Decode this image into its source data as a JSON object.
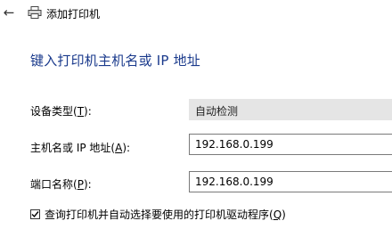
{
  "window": {
    "title": "添加打印机",
    "back_glyph": "←"
  },
  "heading": "键入打印机主机名或 IP 地址",
  "fields": {
    "device_type": {
      "label_pre": "设备类型(",
      "label_key": "T",
      "label_post": "):",
      "value": "自动检测"
    },
    "host": {
      "label_pre": "主机名或 IP 地址(",
      "label_key": "A",
      "label_post": "):",
      "value": "192.168.0.199"
    },
    "port": {
      "label_pre": "端口名称(",
      "label_key": "P",
      "label_post": "):",
      "value": "192.168.0.199"
    }
  },
  "query_checkbox": {
    "checked": true,
    "label_pre": "查询打印机并自动选择要使用的打印机驱动程序(",
    "label_key": "Q",
    "label_post": ")"
  }
}
